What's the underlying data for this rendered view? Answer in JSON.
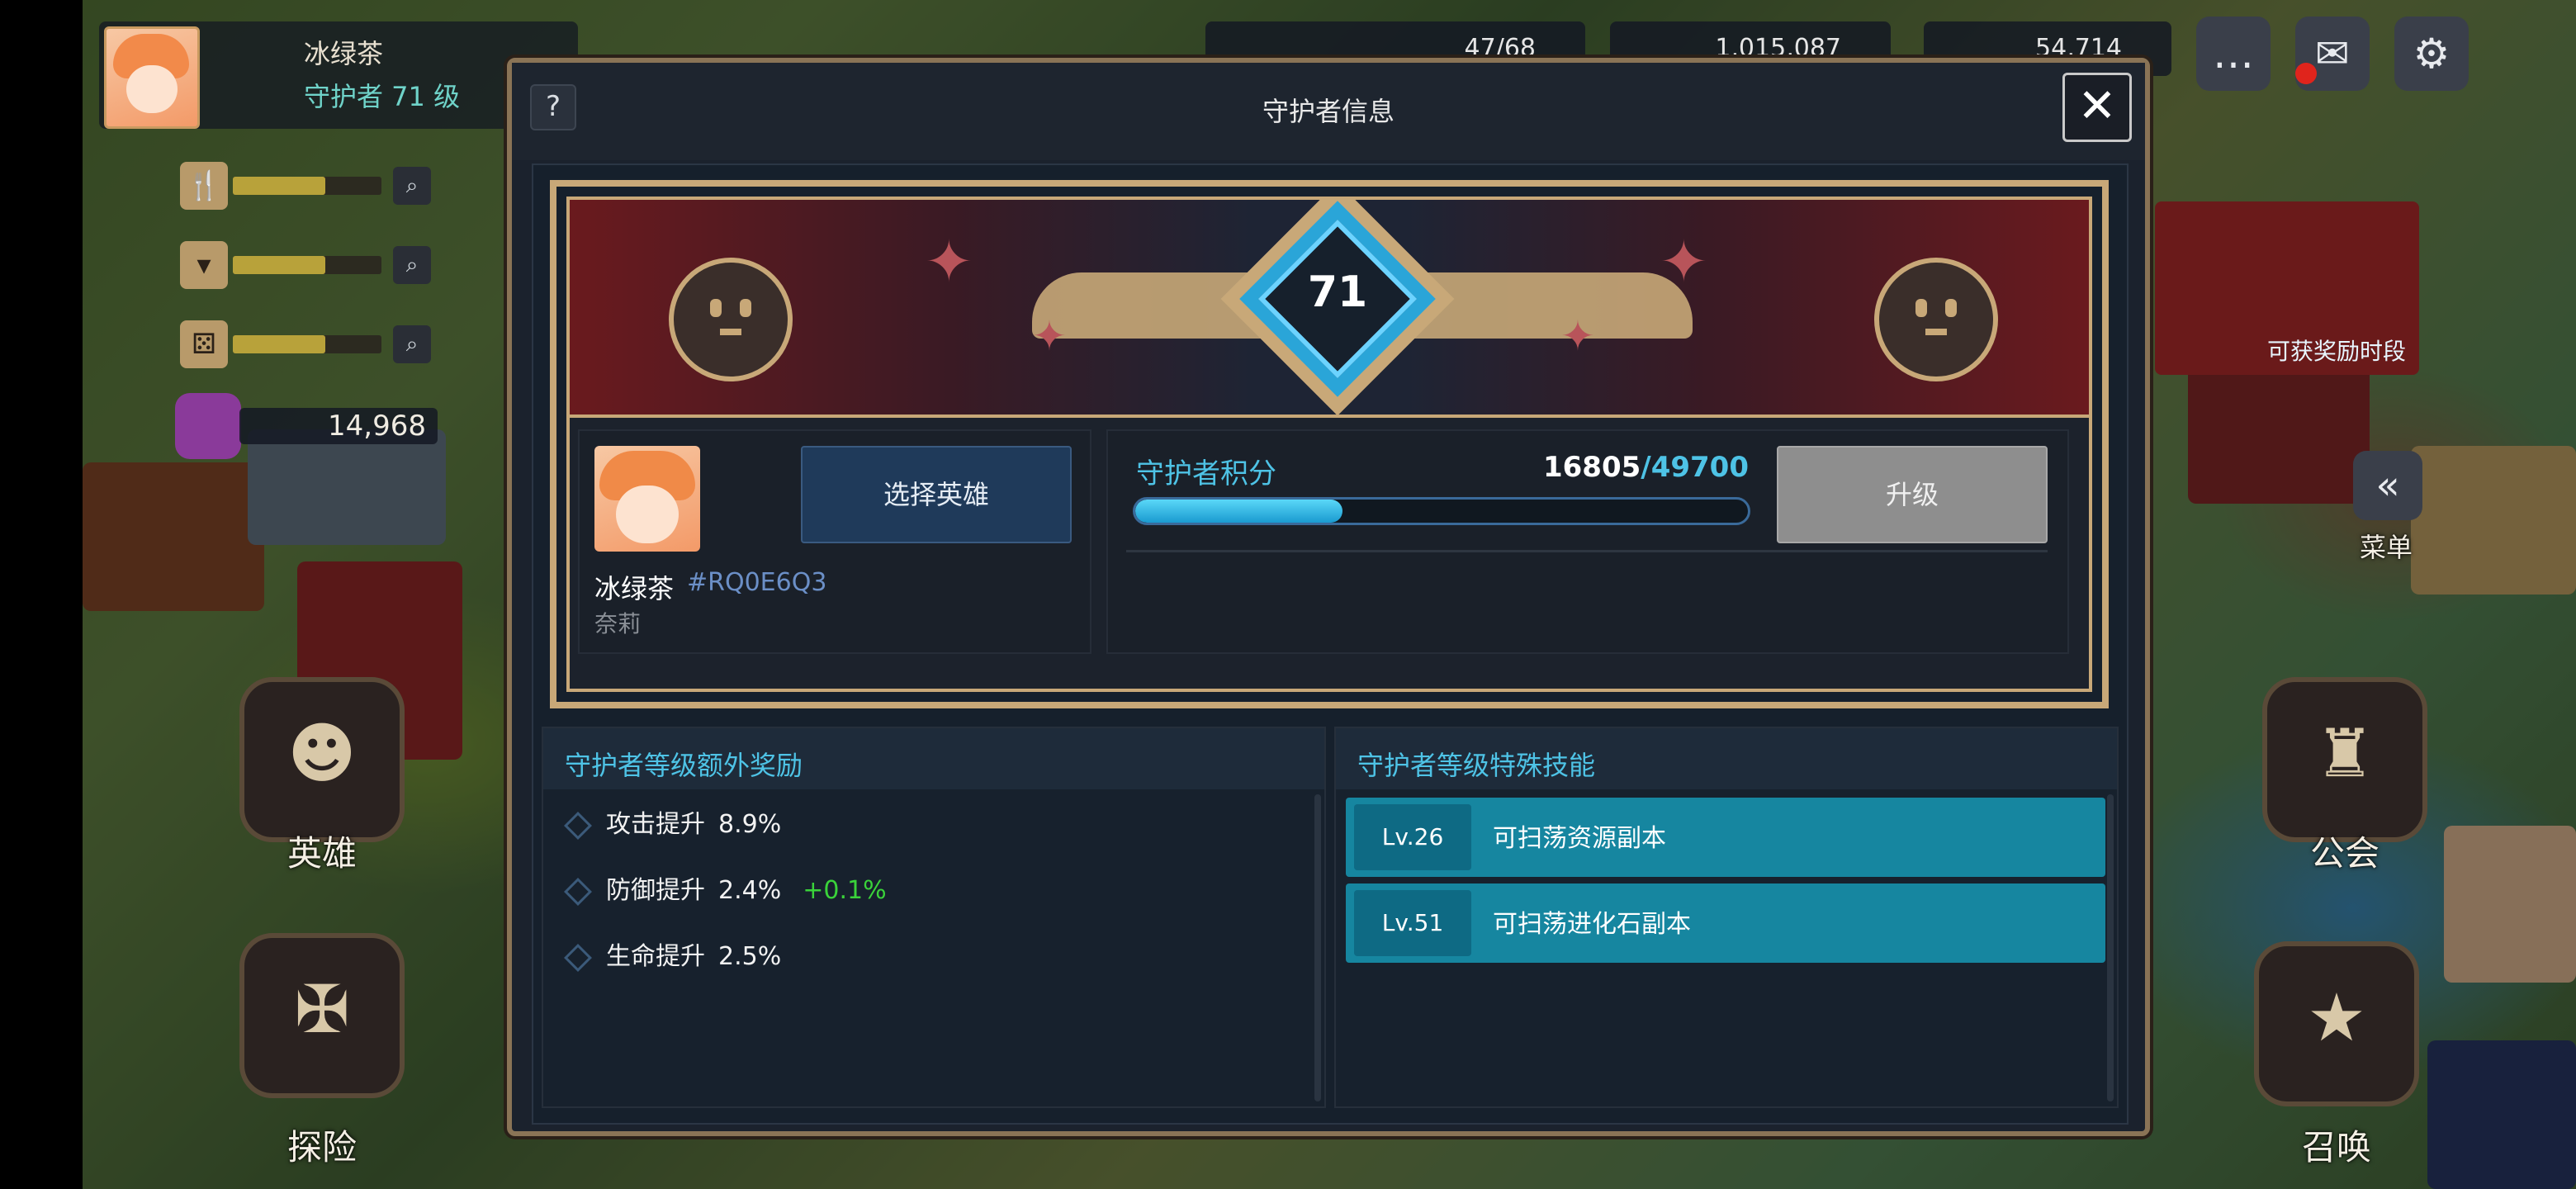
{
  "hud": {
    "player_name": "冰绿茶",
    "player_level": "守护者 71 级",
    "gem_count": "14,968",
    "resources": [
      "47/68",
      "1,015,087",
      "54,714"
    ],
    "stats": [
      {
        "icon": "fork-knife-icon",
        "fill": 0.62
      },
      {
        "icon": "cup-icon",
        "fill": 0.62
      },
      {
        "icon": "dice-icon",
        "fill": 0.62
      }
    ],
    "nav": {
      "hero": "英雄",
      "explore": "探险",
      "guild": "公会",
      "summon": "召唤",
      "menu": "菜单"
    },
    "event_banner_text": "可获奖励时段"
  },
  "dialog": {
    "title": "守护者信息",
    "help": "?",
    "close": "✕",
    "level": "71",
    "profile": {
      "nickname": "冰绿茶",
      "uid": "#RQ0E6Q3",
      "hero_name": "奈莉",
      "select_hero_label": "选择英雄"
    },
    "points": {
      "label": "守护者积分",
      "current": "16805",
      "max": "/49700",
      "progress": 0.338,
      "upgrade_label": "升级"
    },
    "bonus": {
      "title": "守护者等级额外奖励",
      "items": [
        {
          "label": "攻击提升",
          "value": "8.9%",
          "extra": ""
        },
        {
          "label": "防御提升",
          "value": "2.4%",
          "extra": "+0.1%"
        },
        {
          "label": "生命提升",
          "value": "2.5%",
          "extra": ""
        }
      ]
    },
    "skills": {
      "title": "守护者等级特殊技能",
      "items": [
        {
          "level": "Lv.26",
          "text": "可扫荡资源副本"
        },
        {
          "level": "Lv.51",
          "text": "可扫荡进化石副本"
        }
      ]
    }
  }
}
